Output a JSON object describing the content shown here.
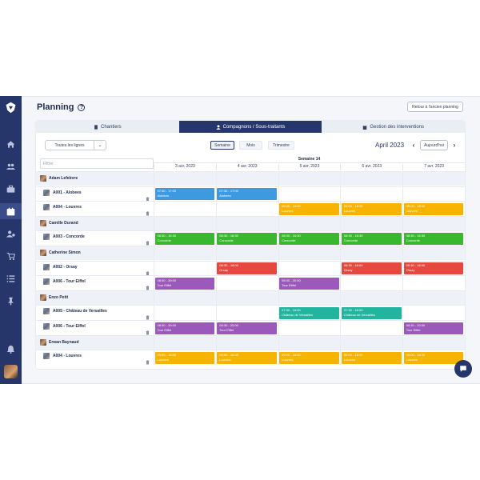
{
  "page": {
    "title": "Planning",
    "old_planning_button": "Retour à l'ancien planning"
  },
  "tabs": [
    {
      "label": "Chantiers",
      "icon": "building-icon",
      "active": false
    },
    {
      "label": "Compagnons / Sous-traitants",
      "icon": "person-icon",
      "active": true
    },
    {
      "label": "Gestion des interventions",
      "icon": "clipboard-icon",
      "active": false
    }
  ],
  "toolbar": {
    "lines_select": "Toutes les lignes",
    "views": [
      "Semaine",
      "Mois",
      "Trimestre"
    ],
    "active_view": "Semaine",
    "month_label": "April 2023",
    "today_button": "Aujourd'hui",
    "filter_placeholder": "Filtrer"
  },
  "calendar": {
    "week_label": "Semaine 14",
    "days": [
      "3 avr. 2023",
      "4 avr. 2023",
      "5 avr. 2023",
      "6 avr. 2023",
      "7 avr. 2023"
    ]
  },
  "colors": {
    "blue": "#3d9ae0",
    "yellow": "#f6b400",
    "green": "#39b72e",
    "red": "#e4483f",
    "purple": "#9b59bb",
    "teal": "#21b5a0",
    "navy": "#26356a"
  },
  "rows": [
    {
      "type": "group",
      "name": "Adam Lefebvre",
      "events": []
    },
    {
      "type": "site",
      "name": "A001 - Alobees",
      "events": [
        {
          "day": 0,
          "time": "07:30 - 17:00",
          "place": "Alobees",
          "color": "blue"
        },
        {
          "day": 1,
          "time": "07:30 - 17:00",
          "place": "Alobees",
          "color": "blue"
        }
      ]
    },
    {
      "type": "site",
      "name": "A004 - Louvres",
      "events": [
        {
          "day": 2,
          "time": "09:00 - 18:00",
          "place": "Louvres",
          "color": "yellow"
        },
        {
          "day": 3,
          "time": "09:00 - 18:00",
          "place": "Louvres",
          "color": "yellow"
        },
        {
          "day": 4,
          "time": "09:00 - 18:00",
          "place": "Louvres",
          "color": "yellow"
        }
      ]
    },
    {
      "type": "group",
      "name": "Camille Durand",
      "events": []
    },
    {
      "type": "site",
      "name": "A003 - Concorde",
      "events": [
        {
          "day": 0,
          "time": "08:30 - 16:30",
          "place": "Concorde",
          "color": "green"
        },
        {
          "day": 1,
          "time": "08:30 - 16:30",
          "place": "Concorde",
          "color": "green"
        },
        {
          "day": 2,
          "time": "08:30 - 16:30",
          "place": "Concorde",
          "color": "green"
        },
        {
          "day": 3,
          "time": "08:30 - 16:30",
          "place": "Concorde",
          "color": "green"
        },
        {
          "day": 4,
          "time": "08:30 - 16:30",
          "place": "Concorde",
          "color": "green"
        }
      ]
    },
    {
      "type": "group",
      "name": "Catherine Simon",
      "events": []
    },
    {
      "type": "site",
      "name": "A002 - Orsay",
      "events": [
        {
          "day": 1,
          "time": "08:30 - 18:00",
          "place": "Orsay",
          "color": "red"
        },
        {
          "day": 3,
          "time": "08:30 - 18:00",
          "place": "Orsay",
          "color": "red"
        },
        {
          "day": 4,
          "time": "08:30 - 18:00",
          "place": "Orsay",
          "color": "red"
        }
      ]
    },
    {
      "type": "site",
      "name": "A006 - Tour Eiffel",
      "events": [
        {
          "day": 0,
          "time": "08:30 - 20:00",
          "place": "Tour Eiffel",
          "color": "purple"
        },
        {
          "day": 2,
          "time": "08:30 - 20:00",
          "place": "Tour Eiffel",
          "color": "purple"
        }
      ]
    },
    {
      "type": "group",
      "name": "Enzo Petit",
      "events": []
    },
    {
      "type": "site",
      "name": "A005 - Château de Versailles",
      "events": [
        {
          "day": 2,
          "time": "07:30 - 18:00",
          "place": "Château de Versailles",
          "color": "teal"
        },
        {
          "day": 3,
          "time": "07:30 - 18:00",
          "place": "Château de Versailles",
          "color": "teal"
        }
      ]
    },
    {
      "type": "site",
      "name": "A006 - Tour Eiffel",
      "events": [
        {
          "day": 0,
          "time": "08:30 - 20:00",
          "place": "Tour Eiffel",
          "color": "purple"
        },
        {
          "day": 1,
          "time": "08:30 - 20:00",
          "place": "Tour Eiffel",
          "color": "purple"
        },
        {
          "day": 4,
          "time": "08:30 - 20:00",
          "place": "Tour Eiffel",
          "color": "purple"
        }
      ]
    },
    {
      "type": "group",
      "name": "Erwan Baynaud",
      "events": []
    },
    {
      "type": "site",
      "name": "A004 - Louvres",
      "events": [
        {
          "day": 0,
          "time": "09:00 - 18:00",
          "place": "Louvres",
          "color": "yellow"
        },
        {
          "day": 1,
          "time": "09:00 - 18:00",
          "place": "Louvres",
          "color": "yellow"
        },
        {
          "day": 2,
          "time": "09:00 - 18:00",
          "place": "Louvres",
          "color": "yellow"
        },
        {
          "day": 3,
          "time": "09:00 - 18:00",
          "place": "Louvres",
          "color": "yellow"
        },
        {
          "day": 4,
          "time": "09:00 - 18:00",
          "place": "Louvres",
          "color": "yellow"
        }
      ]
    }
  ],
  "sidebar": {
    "items": [
      {
        "icon": "home-icon",
        "active": false
      },
      {
        "icon": "users-icon",
        "active": false
      },
      {
        "icon": "briefcase-icon",
        "active": false
      },
      {
        "icon": "calendar-icon",
        "active": true
      },
      {
        "icon": "user-settings-icon",
        "active": false
      },
      {
        "icon": "cart-icon",
        "active": false
      },
      {
        "icon": "list-icon",
        "active": false
      },
      {
        "icon": "pin-icon",
        "active": false
      },
      {
        "icon": "bell-icon",
        "active": false
      }
    ]
  }
}
